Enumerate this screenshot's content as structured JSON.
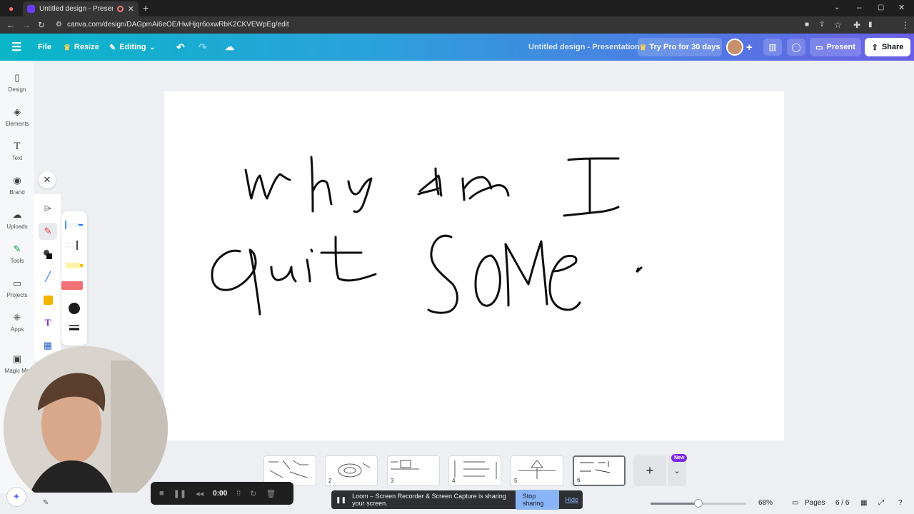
{
  "browser": {
    "tab_title": "Untitled design - Presentatio",
    "url": "canva.com/design/DAGpmAi6eOE/HwHjqr6oxwRbK2CKVEWpEg/edit"
  },
  "header": {
    "file_label": "File",
    "resize_label": "Resize",
    "editing_label": "Editing",
    "doc_title": "Untitled design - Presentation",
    "try_pro_label": "Try Pro for 30 days",
    "present_label": "Present",
    "share_label": "Share"
  },
  "sidebar": {
    "items": [
      {
        "label": "Design",
        "icon": "layout-icon"
      },
      {
        "label": "Elements",
        "icon": "shapes-icon"
      },
      {
        "label": "Text",
        "icon": "text-icon"
      },
      {
        "label": "Brand",
        "icon": "brand-icon"
      },
      {
        "label": "Uploads",
        "icon": "cloud-upload-icon"
      },
      {
        "label": "Tools",
        "icon": "pen-tool-icon"
      },
      {
        "label": "Projects",
        "icon": "folder-icon"
      },
      {
        "label": "Apps",
        "icon": "apps-icon"
      },
      {
        "label": "Magic Me",
        "icon": "magic-media-icon"
      }
    ]
  },
  "canvas": {
    "handwriting_line1": "why am I",
    "handwriting_line2": "quit some"
  },
  "pages": {
    "thumb_numbers": [
      "2",
      "3",
      "4",
      "5",
      "6"
    ],
    "new_badge": "New",
    "counter": "6 / 6",
    "label": "Pages"
  },
  "footer": {
    "zoom": "68%",
    "zoom_fraction": 0.5,
    "rec_time": "0:00",
    "loom_message": "Loom – Screen Recorder & Screen Capture is sharing your screen.",
    "stop_sharing": "Stop sharing",
    "hide": "Hide"
  }
}
